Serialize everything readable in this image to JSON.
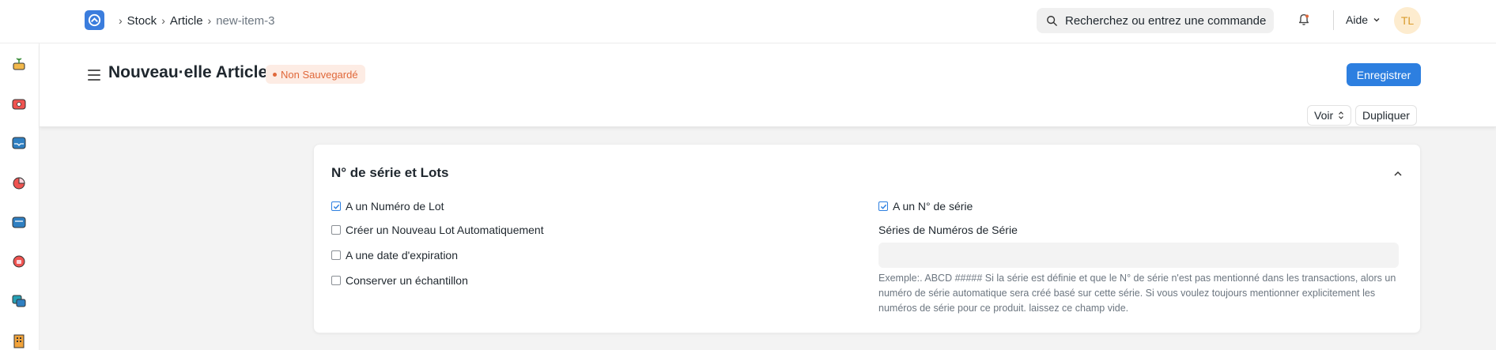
{
  "navbar": {
    "breadcrumbs": [
      "Stock",
      "Article",
      "new-item-3"
    ],
    "search_placeholder": "Recherchez ou entrez une commande",
    "help_label": "Aide",
    "avatar_initials": "TL"
  },
  "sidebar": {
    "icons": [
      "plant-pot-icon",
      "toolbox-icon",
      "inbox-icon",
      "pie-chart-icon",
      "archive-box-icon",
      "support-icon",
      "folders-icon",
      "building-icon"
    ]
  },
  "page": {
    "title": "Nouveau·elle Article",
    "status_badge": "Non Sauvegardé",
    "save_label": "Enregistrer",
    "view_label": "Voir",
    "duplicate_label": "Dupliquer"
  },
  "section": {
    "title": "N° de série et Lots",
    "left_checkboxes": [
      {
        "label": "A un Numéro de Lot",
        "checked": true
      },
      {
        "label": "Créer un Nouveau Lot Automatiquement",
        "checked": false
      },
      {
        "label": "A une date d'expiration",
        "checked": false
      },
      {
        "label": "Conserver un échantillon",
        "checked": false
      }
    ],
    "right_checkbox": {
      "label": "A un N° de série",
      "checked": true
    },
    "series_label": "Séries de Numéros de Série",
    "series_value": "",
    "series_help": "Exemple:. ABCD ##### Si la série est définie et que le N° de série n'est pas mentionné dans les transactions, alors un numéro de série automatique sera créé basé sur cette série. Si vous voulez toujours mentionner explicitement les numéros de série pour ce produit. laissez ce champ vide."
  },
  "colors": {
    "primary": "#2d7fe0",
    "unsaved": "#e0683a",
    "avatar_bg": "#fdeccf"
  }
}
